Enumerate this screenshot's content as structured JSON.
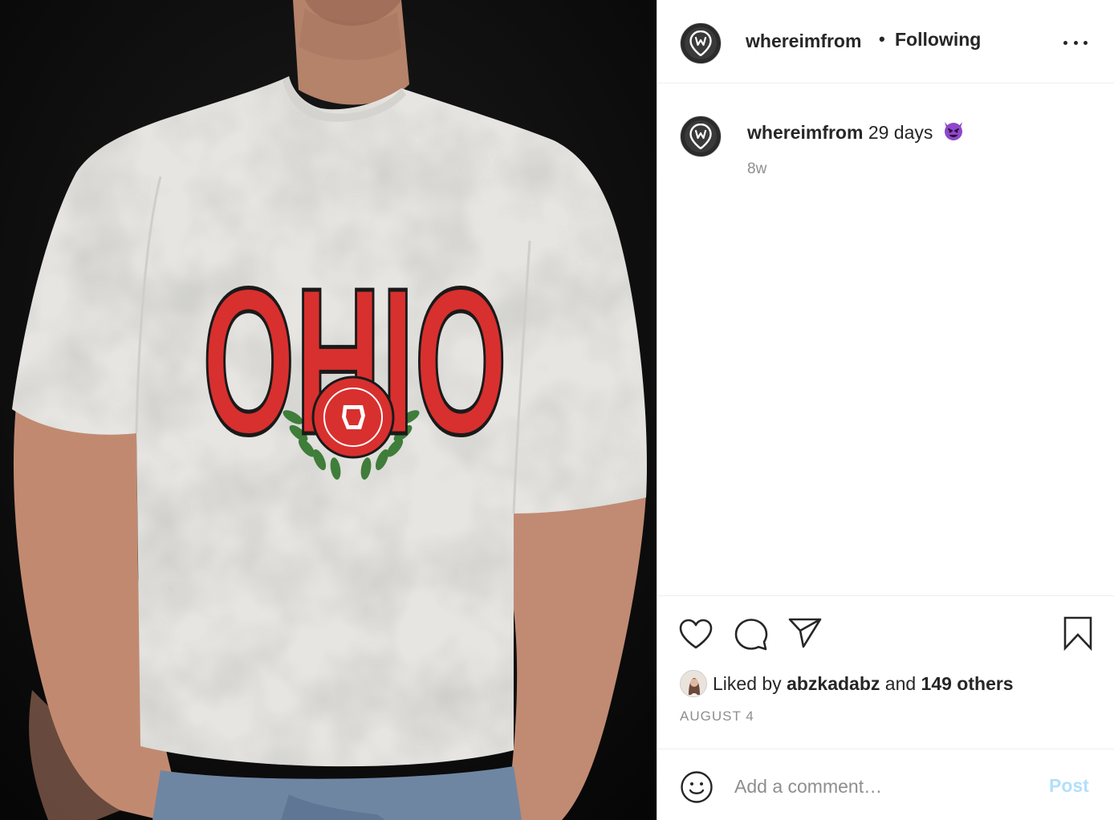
{
  "header": {
    "username": "whereimfrom",
    "separator": "•",
    "follow_status": "Following"
  },
  "photo": {
    "shirt_print": "OHIO"
  },
  "caption": {
    "username": "whereimfrom",
    "text": "29 days",
    "emoji_icon": "smiling-devil-emoji",
    "time_ago": "8w"
  },
  "actions": {
    "like_icon": "heart-icon",
    "comment_icon": "comment-bubble-icon",
    "share_icon": "paper-plane-icon",
    "save_icon": "bookmark-icon"
  },
  "likes": {
    "prefix": "Liked by",
    "liker": "abzkadabz",
    "joiner": "and",
    "others": "149 others"
  },
  "date": "AUGUST 4",
  "comment": {
    "placeholder": "Add a comment…",
    "post_label": "Post",
    "emoji_icon": "smiley-face-icon"
  },
  "colors": {
    "text": "#262626",
    "muted": "#8e8e8e",
    "post_disabled": "#b2dffc",
    "shirt_red": "#d8302e",
    "leaf_green": "#3f7d3a",
    "devil_purple": "#8e47c9"
  }
}
